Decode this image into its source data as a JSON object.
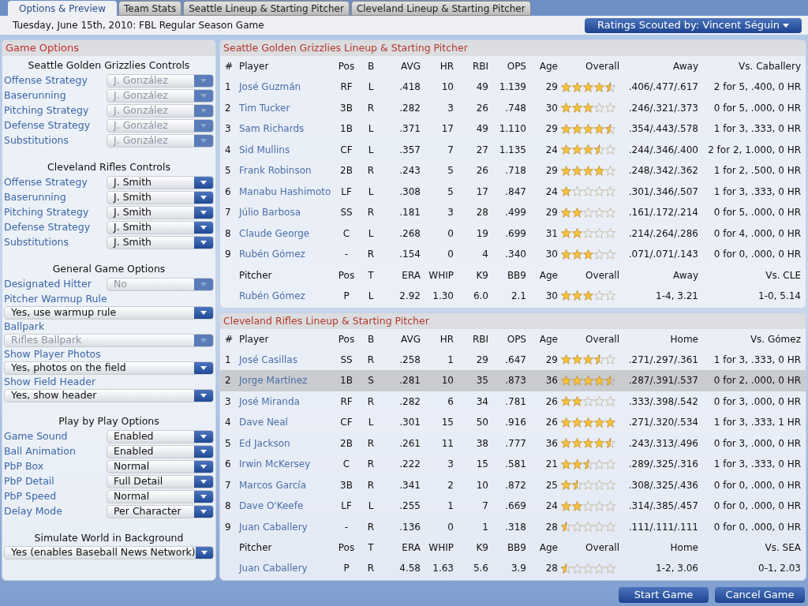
{
  "tabs": [
    {
      "label": "Options & Preview",
      "selected": true
    },
    {
      "label": "Team Stats",
      "selected": false
    },
    {
      "label": "Seattle Lineup & Starting Pitcher",
      "selected": false
    },
    {
      "label": "Cleveland Lineup & Starting Pitcher",
      "selected": false
    }
  ],
  "date_line": "Tuesday, June 15th, 2010: FBL Regular Season Game",
  "scout_button": "Ratings Scouted by: Vincent Séguin",
  "game_options": {
    "title": "Game Options",
    "sections": [
      {
        "title": "Seattle Golden Grizzlies Controls",
        "options": [
          {
            "kind": "inline",
            "label": "Offense Strategy",
            "value": "J. González",
            "disabled": true
          },
          {
            "kind": "inline",
            "label": "Baserunning",
            "value": "J. González",
            "disabled": true
          },
          {
            "kind": "inline",
            "label": "Pitching Strategy",
            "value": "J. González",
            "disabled": true
          },
          {
            "kind": "inline",
            "label": "Defense Strategy",
            "value": "J. González",
            "disabled": true
          },
          {
            "kind": "inline",
            "label": "Substitutions",
            "value": "J. González",
            "disabled": true
          }
        ]
      },
      {
        "title": "Cleveland Rifles Controls",
        "options": [
          {
            "kind": "inline",
            "label": "Offense Strategy",
            "value": "J. Smith",
            "disabled": false
          },
          {
            "kind": "inline",
            "label": "Baserunning",
            "value": "J. Smith",
            "disabled": false
          },
          {
            "kind": "inline",
            "label": "Pitching Strategy",
            "value": "J. Smith",
            "disabled": false
          },
          {
            "kind": "inline",
            "label": "Defense Strategy",
            "value": "J. Smith",
            "disabled": false
          },
          {
            "kind": "inline",
            "label": "Substitutions",
            "value": "J. Smith",
            "disabled": false
          }
        ]
      },
      {
        "title": "General Game Options",
        "options": [
          {
            "kind": "inline",
            "label": "Designated Hitter",
            "value": "No",
            "disabled": true
          },
          {
            "kind": "stacked",
            "label": "Pitcher Warmup Rule",
            "value": "Yes, use warmup rule",
            "disabled": false
          },
          {
            "kind": "stacked",
            "label": "Ballpark",
            "value": "Rifles Ballpark",
            "disabled": true
          },
          {
            "kind": "stacked",
            "label": "Show Player Photos",
            "value": "Yes, photos on the field",
            "disabled": false
          },
          {
            "kind": "stacked",
            "label": "Show Field Header",
            "value": "Yes, show header",
            "disabled": false
          }
        ]
      },
      {
        "title": "Play by Play Options",
        "options": [
          {
            "kind": "inline",
            "label": "Game Sound",
            "value": "Enabled",
            "disabled": false
          },
          {
            "kind": "inline",
            "label": "Ball Animation",
            "value": "Enabled",
            "disabled": false
          },
          {
            "kind": "inline",
            "label": "PbP Box",
            "value": "Normal",
            "disabled": false
          },
          {
            "kind": "inline",
            "label": "PbP Detail",
            "value": "Full Detail",
            "disabled": false
          },
          {
            "kind": "inline",
            "label": "PbP Speed",
            "value": "Normal",
            "disabled": false
          },
          {
            "kind": "inline",
            "label": "Delay Mode",
            "value": "Per Character",
            "disabled": false
          }
        ]
      },
      {
        "title": "Simulate World in Background",
        "options": [
          {
            "kind": "stacked",
            "value": "Yes (enables Baseball News Network)",
            "disabled": false
          }
        ]
      }
    ]
  },
  "lineups": [
    {
      "title": "Seattle Golden Grizzlies Lineup & Starting Pitcher",
      "columns": [
        "#",
        "Player",
        "Pos",
        "B",
        "AVG",
        "HR",
        "RBI",
        "OPS",
        "Age",
        "Overall",
        "Away",
        "Vs. Caballery"
      ],
      "rows": [
        {
          "cells": [
            "1",
            "José Guzmán",
            "RF",
            "L",
            ".418",
            "10",
            "49",
            "1.139",
            "29"
          ],
          "stars": 4.5,
          "split": ".406/.477/.617",
          "vs": "2 for 5, .400, 0 HR",
          "selected": false
        },
        {
          "cells": [
            "2",
            "Tim Tucker",
            "3B",
            "R",
            ".282",
            "3",
            "26",
            ".748",
            "30"
          ],
          "stars": 3,
          "split": ".246/.321/.373",
          "vs": "0 for 5, .000, 0 HR",
          "selected": false
        },
        {
          "cells": [
            "3",
            "Sam Richards",
            "1B",
            "L",
            ".371",
            "17",
            "49",
            "1.110",
            "29"
          ],
          "stars": 4.5,
          "split": ".354/.443/.578",
          "vs": "1 for 3, .333, 0 HR",
          "selected": false
        },
        {
          "cells": [
            "4",
            "Sid Mullins",
            "CF",
            "L",
            ".357",
            "7",
            "27",
            "1.135",
            "24"
          ],
          "stars": 3.5,
          "split": ".244/.346/.400",
          "vs": "2 for 2, 1.000, 0 HR",
          "selected": false
        },
        {
          "cells": [
            "5",
            "Frank Robinson",
            "2B",
            "R",
            ".243",
            "5",
            "26",
            ".718",
            "29"
          ],
          "stars": 4,
          "split": ".248/.342/.362",
          "vs": "1 for 2, .500, 0 HR",
          "selected": false
        },
        {
          "cells": [
            "6",
            "Manabu Hashimoto",
            "LF",
            "L",
            ".308",
            "5",
            "17",
            ".847",
            "24"
          ],
          "stars": 1,
          "split": ".301/.346/.507",
          "vs": "1 for 3, .333, 0 HR",
          "selected": false
        },
        {
          "cells": [
            "7",
            "Júlio Barbosa",
            "SS",
            "R",
            ".181",
            "3",
            "28",
            ".499",
            "29"
          ],
          "stars": 2,
          "split": ".161/.172/.214",
          "vs": "0 for 5, .000, 0 HR",
          "selected": false
        },
        {
          "cells": [
            "8",
            "Claude George",
            "C",
            "L",
            ".268",
            "0",
            "19",
            ".699",
            "31"
          ],
          "stars": 2,
          "split": ".214/.264/.286",
          "vs": "0 for 4, .000, 0 HR",
          "selected": false
        },
        {
          "cells": [
            "9",
            "Rubén Gómez",
            "-",
            "R",
            ".154",
            "0",
            "4",
            ".340",
            "30"
          ],
          "stars": 3,
          "split": ".071/.071/.143",
          "vs": "0 for 0, .000, 0 HR",
          "selected": false
        }
      ],
      "pitcher_columns": [
        "Pitcher",
        "Pos",
        "T",
        "ERA",
        "WHIP",
        "K9",
        "BB9",
        "Age",
        "Overall",
        "Away",
        "Vs. CLE"
      ],
      "pitcher": {
        "cells": [
          "Rubén Gómez",
          "P",
          "L",
          "2.92",
          "1.30",
          "6.0",
          "2.1",
          "30"
        ],
        "stars": 3,
        "split": "1-4, 3.21",
        "vs": "1-0, 5.14"
      }
    },
    {
      "title": "Cleveland Rifles Lineup & Starting Pitcher",
      "columns": [
        "#",
        "Player",
        "Pos",
        "B",
        "AVG",
        "HR",
        "RBI",
        "OPS",
        "Age",
        "Overall",
        "Home",
        "Vs. Gómez"
      ],
      "rows": [
        {
          "cells": [
            "1",
            "José Casillas",
            "SS",
            "R",
            ".258",
            "1",
            "29",
            ".647",
            "29"
          ],
          "stars": 3.5,
          "split": ".271/.297/.361",
          "vs": "1 for 3, .333, 0 HR",
          "selected": false
        },
        {
          "cells": [
            "2",
            "Jorge Martínez",
            "1B",
            "S",
            ".281",
            "10",
            "35",
            ".873",
            "36"
          ],
          "stars": 4.5,
          "split": ".287/.391/.537",
          "vs": "0 for 2, .000, 0 HR",
          "selected": true
        },
        {
          "cells": [
            "3",
            "José Miranda",
            "RF",
            "R",
            ".282",
            "6",
            "34",
            ".781",
            "26"
          ],
          "stars": 2,
          "split": ".333/.398/.542",
          "vs": "0 for 3, .000, 0 HR",
          "selected": false
        },
        {
          "cells": [
            "4",
            "Dave Neal",
            "CF",
            "L",
            ".301",
            "15",
            "50",
            ".916",
            "26"
          ],
          "stars": 5,
          "split": ".271/.320/.534",
          "vs": "1 for 3, .333, 1 HR",
          "selected": false
        },
        {
          "cells": [
            "5",
            "Ed Jackson",
            "2B",
            "R",
            ".261",
            "11",
            "38",
            ".777",
            "36"
          ],
          "stars": 4.5,
          "split": ".243/.313/.496",
          "vs": "0 for 3, .000, 0 HR",
          "selected": false
        },
        {
          "cells": [
            "6",
            "Irwin McKersey",
            "C",
            "R",
            ".222",
            "3",
            "15",
            ".581",
            "21"
          ],
          "stars": 2.5,
          "split": ".289/.325/.316",
          "vs": "1 for 3, .333, 0 HR",
          "selected": false
        },
        {
          "cells": [
            "7",
            "Marcos García",
            "3B",
            "R",
            ".341",
            "2",
            "10",
            ".872",
            "25"
          ],
          "stars": 1.5,
          "split": ".308/.325/.436",
          "vs": "0 for 0, .000, 0 HR",
          "selected": false
        },
        {
          "cells": [
            "8",
            "Dave O'Keefe",
            "LF",
            "L",
            ".255",
            "1",
            "7",
            ".669",
            "24"
          ],
          "stars": 2,
          "split": ".314/.385/.457",
          "vs": "0 for 0, .000, 0 HR",
          "selected": false
        },
        {
          "cells": [
            "9",
            "Juan Caballery",
            "-",
            "R",
            ".136",
            "0",
            "1",
            ".318",
            "28"
          ],
          "stars": 0.5,
          "split": ".111/.111/.111",
          "vs": "0 for 0, .000, 0 HR",
          "selected": false
        }
      ],
      "pitcher_columns": [
        "Pitcher",
        "Pos",
        "T",
        "ERA",
        "WHIP",
        "K9",
        "BB9",
        "Age",
        "Overall",
        "Home",
        "Vs. SEA"
      ],
      "pitcher": {
        "cells": [
          "Juan Caballery",
          "P",
          "R",
          "4.58",
          "1.63",
          "5.6",
          "3.9",
          "28"
        ],
        "stars": 0.5,
        "split": "1-2, 3.06",
        "vs": "0-1, 2.03"
      }
    }
  ],
  "buttons": [
    "Start Game",
    "Cancel Game"
  ]
}
